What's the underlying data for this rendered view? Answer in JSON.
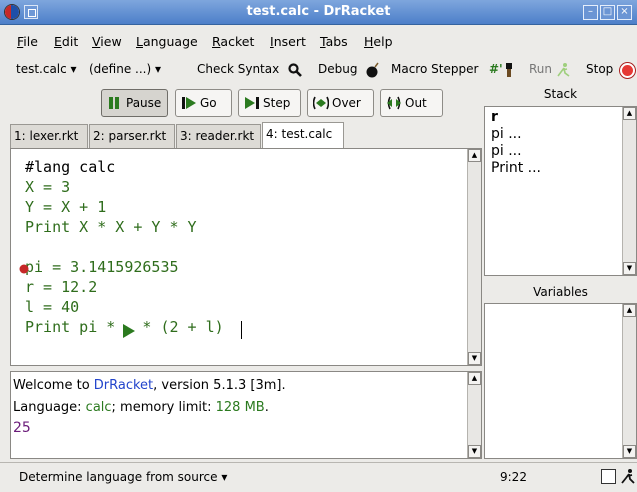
{
  "window": {
    "title": "test.calc - DrRacket"
  },
  "menu": [
    "File",
    "Edit",
    "View",
    "Language",
    "Racket",
    "Insert",
    "Tabs",
    "Help"
  ],
  "toolbar": {
    "file_selector": "test.calc ▾",
    "define_selector": "(define ...) ▾",
    "check_syntax": "Check Syntax",
    "debug": "Debug",
    "macro_stepper": "Macro Stepper",
    "macro_stepper_glyph": "#'",
    "run": "Run",
    "stop": "Stop"
  },
  "debugger": {
    "pause": "Pause",
    "go": "Go",
    "step": "Step",
    "over": "Over",
    "out": "Out"
  },
  "tabs": [
    "1: lexer.rkt",
    "2: parser.rkt",
    "3: reader.rkt",
    "4: test.calc"
  ],
  "editor": {
    "lines": [
      {
        "text": "#lang calc",
        "color": "#000000"
      },
      {
        "text": "X = 3",
        "color": "#2f6d1c"
      },
      {
        "text": "Y = X + 1",
        "color": "#2f6d1c"
      },
      {
        "text": "Print X * X + Y * Y",
        "color": "#2f6d1c"
      },
      {
        "text": "",
        "color": "#000000"
      },
      {
        "text": "pi = 3.1415926535",
        "color": "#2f6d1c"
      },
      {
        "text": "r = 12.2",
        "color": "#2f6d1c"
      },
      {
        "text": "l = 40",
        "color": "#2f6d1c"
      },
      {
        "text": "Print pi *   * (2 + l)",
        "color": "#2f6d1c"
      }
    ]
  },
  "interactions": {
    "welcome_prefix": "Welcome to ",
    "drracket_link": "DrRacket",
    "welcome_suffix": ", version 5.1.3 [3m].",
    "language_prefix": "Language: ",
    "language_name": "calc",
    "language_middle": "; memory limit: ",
    "memory": "128 MB",
    "language_suffix": ".",
    "result": "25"
  },
  "stack": {
    "title": "Stack",
    "items": [
      "r",
      "pi ...",
      "pi ...",
      "Print ..."
    ]
  },
  "variables": {
    "title": "Variables"
  },
  "status": {
    "language": "Determine language from source ▾",
    "time": "9:22"
  },
  "colors": {
    "code": "#2f6d1c",
    "link": "#2244cc",
    "result": "#6a1b79"
  }
}
